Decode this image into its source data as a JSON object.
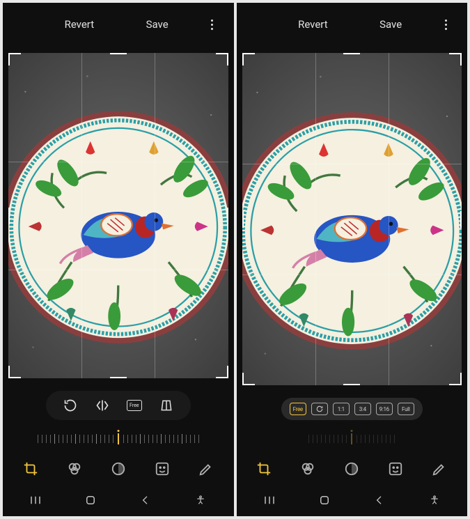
{
  "header": {
    "revert_label": "Revert",
    "save_label": "Save"
  },
  "left_panel": {
    "crop_tools": [
      {
        "name": "rotate"
      },
      {
        "name": "flip"
      },
      {
        "name": "free"
      },
      {
        "name": "perspective"
      }
    ]
  },
  "right_panel": {
    "aspect_ratios": [
      {
        "label": "Free",
        "active": true,
        "name": "ratio-free"
      },
      {
        "label": "",
        "active": false,
        "name": "ratio-original"
      },
      {
        "label": "1:1",
        "active": false,
        "name": "ratio-1-1"
      },
      {
        "label": "3:4",
        "active": false,
        "name": "ratio-3-4"
      },
      {
        "label": "9:16",
        "active": false,
        "name": "ratio-9-16"
      },
      {
        "label": "Full",
        "active": false,
        "name": "ratio-full"
      }
    ]
  },
  "tabs": [
    {
      "name": "crop",
      "active": true
    },
    {
      "name": "filters",
      "active": false
    },
    {
      "name": "adjust",
      "active": false
    },
    {
      "name": "stickers",
      "active": false
    },
    {
      "name": "draw",
      "active": false
    }
  ],
  "colors": {
    "accent": "#f3c63f",
    "bg": "#0f0f0f"
  }
}
